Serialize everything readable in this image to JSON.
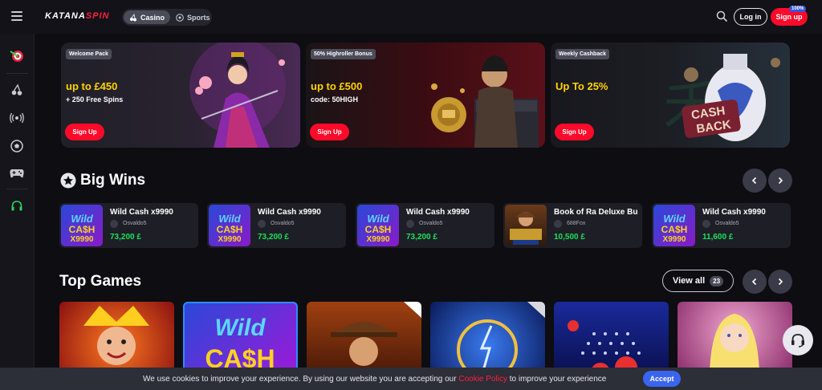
{
  "header": {
    "logo_part1": "KATANA",
    "logo_part2": "SPIN",
    "modes": [
      {
        "label": "Casino",
        "icon": "cherries-icon",
        "active": true
      },
      {
        "label": "Sports",
        "icon": "soccer-ball-icon",
        "active": false
      }
    ],
    "login_label": "Log in",
    "signup_label": "Sign up",
    "signup_badge": "100%"
  },
  "sidebar": {
    "items": [
      "target-icon",
      "cherries-icon",
      "live-broadcast-icon",
      "soccer-ball-icon",
      "gamepad-icon",
      "headset-icon"
    ]
  },
  "promos": [
    {
      "tag": "Welcome Pack",
      "headline": "up to £450",
      "sub": "+ 250 Free Spins",
      "cta": "Sign Up",
      "bg": "#1f1f2a"
    },
    {
      "tag": "50% Highroller Bonus",
      "headline": "up to £500",
      "sub": "code: 50HIGH",
      "cta": "Sign Up",
      "bg": "#3a0d12"
    },
    {
      "tag": "Weekly Cashback",
      "headline": "Up To 25%",
      "sub": "",
      "cta": "Sign Up",
      "bg": "#1b1b22"
    }
  ],
  "big_wins": {
    "title": "Big Wins",
    "items": [
      {
        "game": "Wild Cash x9990",
        "user": "Osvaldo5",
        "amount": "73,200 £"
      },
      {
        "game": "Wild Cash x9990",
        "user": "Osvaldo5",
        "amount": "73,200 £"
      },
      {
        "game": "Wild Cash x9990",
        "user": "Osvaldo5",
        "amount": "73,200 £"
      },
      {
        "game": "Book of Ra Deluxe Bu",
        "user": "688Fox",
        "amount": "10,500 £"
      },
      {
        "game": "Wild Cash x9990",
        "user": "Osvaldo5",
        "amount": "11,600 £"
      }
    ]
  },
  "top_games": {
    "title": "Top Games",
    "view_all_label": "View all",
    "view_all_count": "23"
  },
  "cookie": {
    "text_before": "We use cookies to improve your experience. By using our website you are accepting our ",
    "link": "Cookie Policy",
    "text_after": " to improve your experience",
    "accept_label": "Accept"
  },
  "colors": {
    "accent": "#ff0a2a",
    "win_amount": "#19e05a",
    "promo_headline": "#ffd300",
    "accept": "#3a64f0"
  }
}
